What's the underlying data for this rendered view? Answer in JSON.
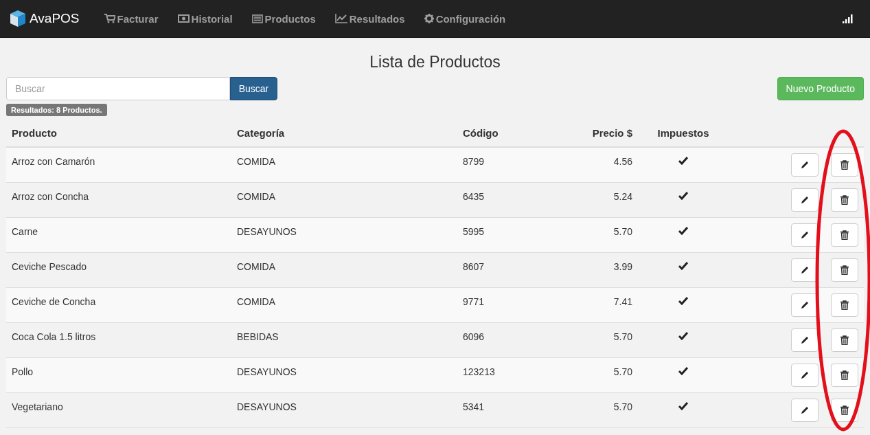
{
  "navbar": {
    "brand": "AvaPOS",
    "items": [
      {
        "label": "Facturar"
      },
      {
        "label": "Historial"
      },
      {
        "label": "Productos"
      },
      {
        "label": "Resultados"
      },
      {
        "label": "Configuración"
      }
    ]
  },
  "title": "Lista de Productos",
  "search": {
    "placeholder": "Buscar",
    "button": "Buscar"
  },
  "new_button": "Nuevo Producto",
  "results_badge": "Resultados: 8 Productos.",
  "table": {
    "columns": [
      "Producto",
      "Categoría",
      "Código",
      "Precio $",
      "Impuestos"
    ],
    "rows": [
      {
        "product": "Arroz con Camarón",
        "category": "COMIDA",
        "code": "8799",
        "price": "4.56",
        "taxed": true
      },
      {
        "product": "Arroz con Concha",
        "category": "COMIDA",
        "code": "6435",
        "price": "5.24",
        "taxed": true
      },
      {
        "product": "Carne",
        "category": "DESAYUNOS",
        "code": "5995",
        "price": "5.70",
        "taxed": true
      },
      {
        "product": "Ceviche Pescado",
        "category": "COMIDA",
        "code": "8607",
        "price": "3.99",
        "taxed": true
      },
      {
        "product": "Ceviche de Concha",
        "category": "COMIDA",
        "code": "9771",
        "price": "7.41",
        "taxed": true
      },
      {
        "product": "Coca Cola 1.5 litros",
        "category": "BEBIDAS",
        "code": "6096",
        "price": "5.70",
        "taxed": true
      },
      {
        "product": "Pollo",
        "category": "DESAYUNOS",
        "code": "123213",
        "price": "5.70",
        "taxed": true
      },
      {
        "product": "Vegetariano",
        "category": "DESAYUNOS",
        "code": "5341",
        "price": "5.70",
        "taxed": true
      }
    ]
  },
  "annotation": {
    "kind": "ellipse",
    "color": "#e3101c"
  }
}
